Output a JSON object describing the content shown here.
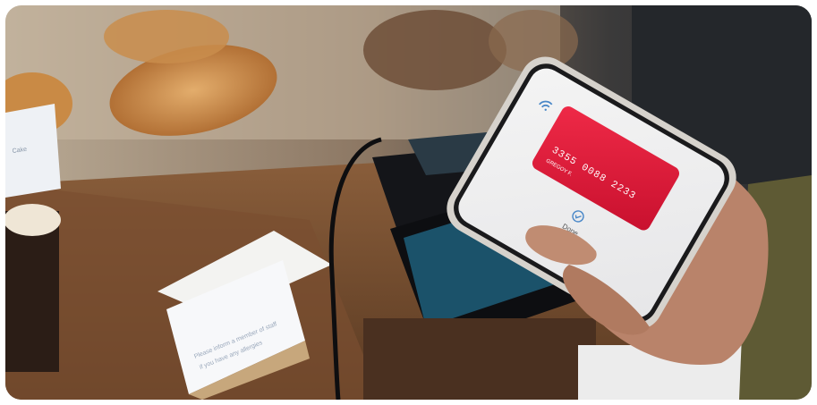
{
  "photo": {
    "phone_screen": {
      "wifi_icon": "contactless-icon",
      "card": {
        "number": "3355 0088 2233",
        "holder": "GREGOY F.",
        "color": "#e01d3c"
      },
      "status_icon": "check-circle-icon",
      "status_label": "Done"
    },
    "sign_text_line1": "Please inform a member of staff",
    "sign_text_line2": "if you have any allergies",
    "small_label_text": "Cake"
  }
}
